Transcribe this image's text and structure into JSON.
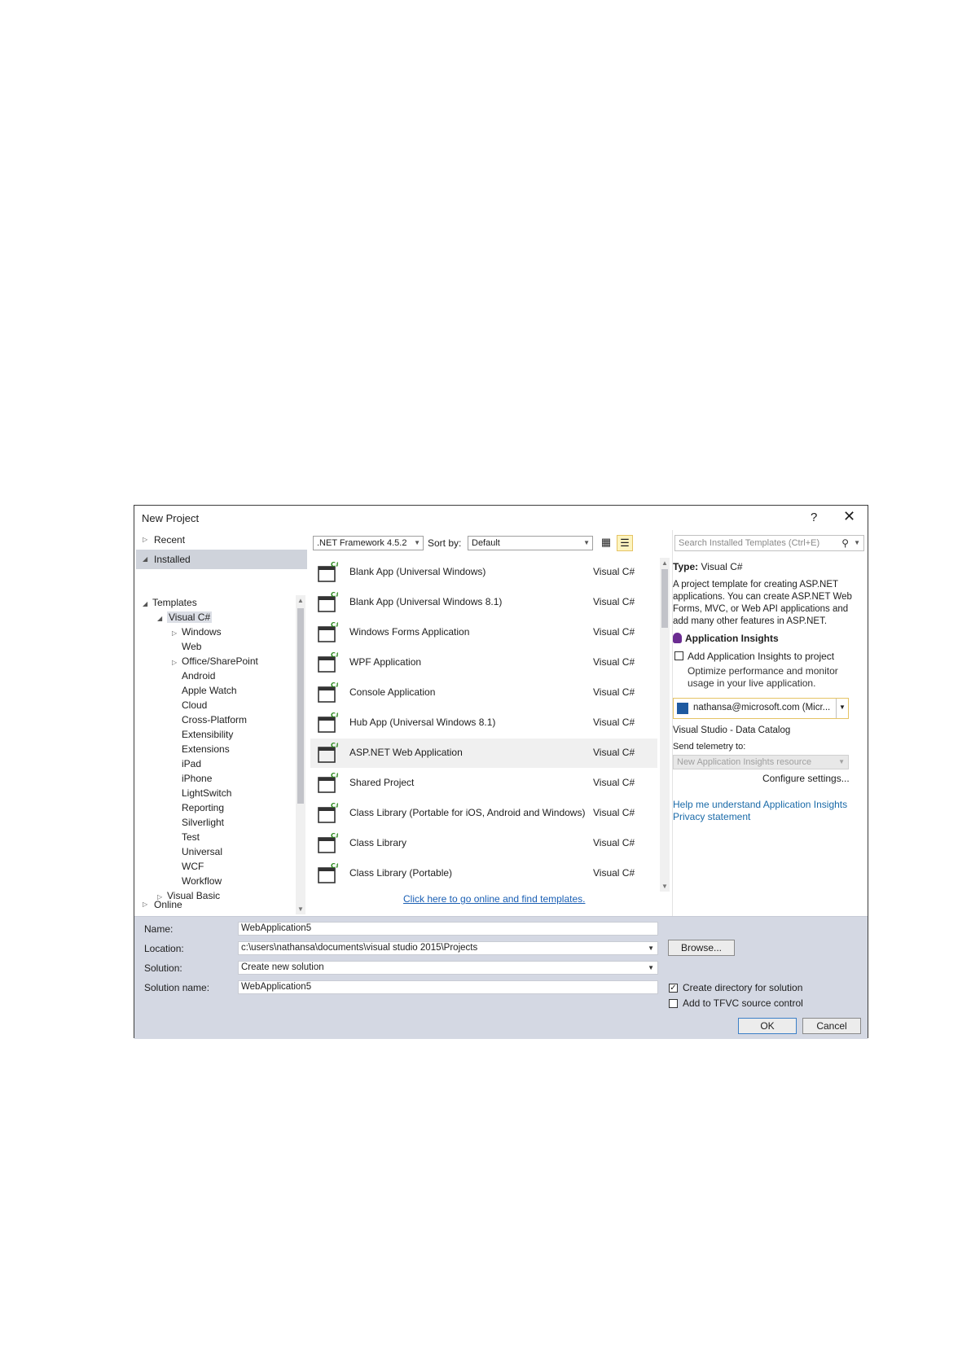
{
  "dialog": {
    "title": "New Project",
    "help": "?",
    "close": "✕"
  },
  "nav": {
    "recent": "Recent",
    "installed": "Installed",
    "online": "Online",
    "tree": [
      {
        "label": "Templates",
        "level": 0,
        "arrow": "◢"
      },
      {
        "label": "Visual C#",
        "level": 1,
        "arrow": "◢",
        "selected": true
      },
      {
        "label": "Windows",
        "level": 2,
        "arrow": "▷"
      },
      {
        "label": "Web",
        "level": 2,
        "arrow": ""
      },
      {
        "label": "Office/SharePoint",
        "level": 2,
        "arrow": "▷"
      },
      {
        "label": "Android",
        "level": 2,
        "arrow": ""
      },
      {
        "label": "Apple Watch",
        "level": 2,
        "arrow": ""
      },
      {
        "label": "Cloud",
        "level": 2,
        "arrow": ""
      },
      {
        "label": "Cross-Platform",
        "level": 2,
        "arrow": ""
      },
      {
        "label": "Extensibility",
        "level": 2,
        "arrow": ""
      },
      {
        "label": "Extensions",
        "level": 2,
        "arrow": ""
      },
      {
        "label": "iPad",
        "level": 2,
        "arrow": ""
      },
      {
        "label": "iPhone",
        "level": 2,
        "arrow": ""
      },
      {
        "label": "LightSwitch",
        "level": 2,
        "arrow": ""
      },
      {
        "label": "Reporting",
        "level": 2,
        "arrow": ""
      },
      {
        "label": "Silverlight",
        "level": 2,
        "arrow": ""
      },
      {
        "label": "Test",
        "level": 2,
        "arrow": ""
      },
      {
        "label": "Universal",
        "level": 2,
        "arrow": ""
      },
      {
        "label": "WCF",
        "level": 2,
        "arrow": ""
      },
      {
        "label": "Workflow",
        "level": 2,
        "arrow": ""
      },
      {
        "label": "Visual Basic",
        "level": 1,
        "arrow": "▷"
      }
    ]
  },
  "toolbar": {
    "framework": ".NET Framework 4.5.2",
    "sort_label": "Sort by:",
    "sort_value": "Default",
    "search_placeholder": "Search Installed Templates (Ctrl+E)"
  },
  "templates": [
    {
      "name": "Blank App (Universal Windows)",
      "lang": "Visual C#",
      "icon": "blank-app-icon"
    },
    {
      "name": "Blank App (Universal Windows 8.1)",
      "lang": "Visual C#",
      "icon": "blank-app-icon"
    },
    {
      "name": "Windows Forms Application",
      "lang": "Visual C#",
      "icon": "windows-forms-icon"
    },
    {
      "name": "WPF Application",
      "lang": "Visual C#",
      "icon": "wpf-icon"
    },
    {
      "name": "Console Application",
      "lang": "Visual C#",
      "icon": "console-icon"
    },
    {
      "name": "Hub App (Universal Windows 8.1)",
      "lang": "Visual C#",
      "icon": "hub-app-icon"
    },
    {
      "name": "ASP.NET Web Application",
      "lang": "Visual C#",
      "icon": "aspnet-icon",
      "selected": true
    },
    {
      "name": "Shared Project",
      "lang": "Visual C#",
      "icon": "shared-project-icon"
    },
    {
      "name": "Class Library (Portable for iOS, Android and Windows)",
      "lang": "Visual C#",
      "icon": "class-library-icon"
    },
    {
      "name": "Class Library",
      "lang": "Visual C#",
      "icon": "class-library-icon"
    },
    {
      "name": "Class Library (Portable)",
      "lang": "Visual C#",
      "icon": "class-library-icon"
    }
  ],
  "online_link": "Click here to go online and find templates.",
  "detail": {
    "type_label": "Type:",
    "type_value": "Visual C#",
    "description": "A project template for creating ASP.NET applications. You can create ASP.NET Web Forms, MVC,  or Web API applications and add many other features in ASP.NET.",
    "ai_title": "Application Insights",
    "ai_checkbox": "Add Application Insights to project",
    "ai_optimize": "Optimize performance and monitor usage in your live application.",
    "account": "nathansa@microsoft.com (Micr...",
    "catalog": "Visual Studio - Data Catalog",
    "send_label": "Send telemetry to:",
    "resource": "New Application Insights resource",
    "configure": "Configure settings...",
    "help_link": "Help me understand Application Insights",
    "privacy_link": "Privacy statement"
  },
  "form": {
    "name_label": "Name:",
    "name_value": "WebApplication5",
    "location_label": "Location:",
    "location_value": "c:\\users\\nathansa\\documents\\visual studio 2015\\Projects",
    "solution_label": "Solution:",
    "solution_value": "Create new solution",
    "solution_name_label": "Solution name:",
    "solution_name_value": "WebApplication5",
    "browse": "Browse...",
    "create_dir": "Create directory for solution",
    "create_dir_checked": true,
    "tfvc": "Add to TFVC source control",
    "tfvc_checked": false,
    "ok": "OK",
    "cancel": "Cancel"
  },
  "colors": {
    "accent": "#1a5fb4",
    "bottom_bg": "#d4d8e3",
    "selection": "#dcdfe6",
    "csharp_badge": "#2e8b1f"
  }
}
